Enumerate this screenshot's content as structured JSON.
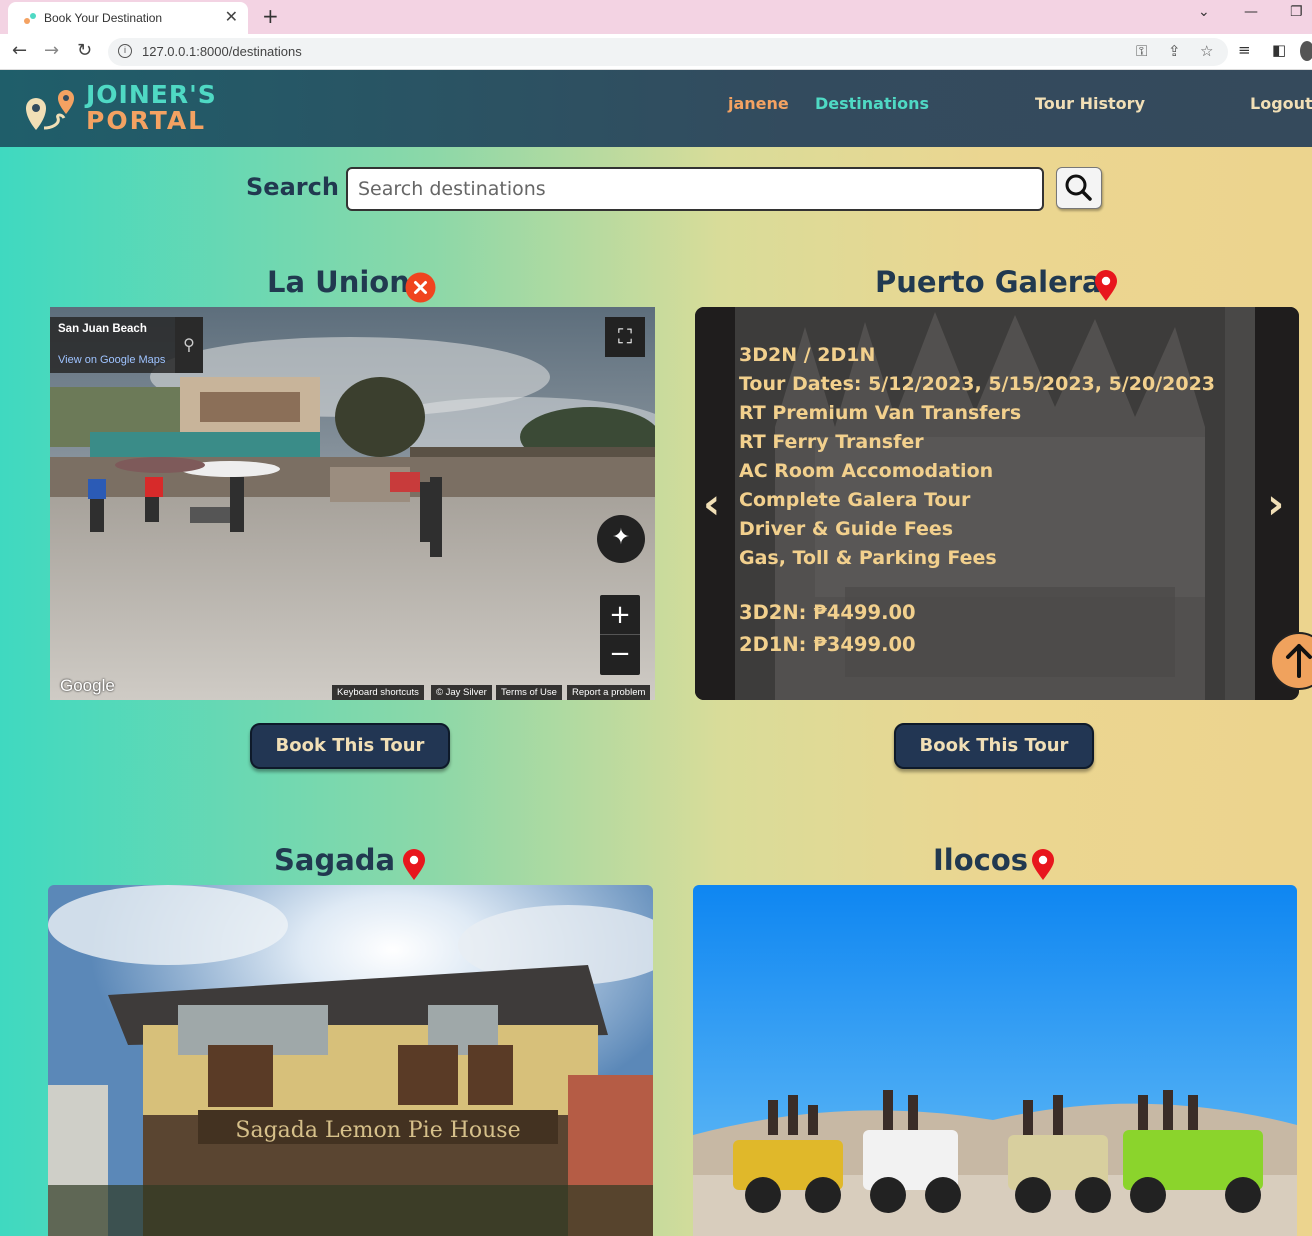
{
  "browser": {
    "tab_title": "Book Your Destination",
    "url": "127.0.0.1:8000/destinations"
  },
  "header": {
    "logo_line1": "JOINER'S",
    "logo_line2": "PORTAL",
    "user": "janene",
    "nav": [
      "Destinations",
      "Tour History",
      "Logout"
    ]
  },
  "search": {
    "label": "Search",
    "placeholder": "Search destinations"
  },
  "destinations": [
    {
      "name": "La Union",
      "streetview": {
        "place": "San Juan Beach",
        "link": "View on Google Maps",
        "footer": [
          "Keyboard shortcuts",
          "© Jay Silver",
          "Terms of Use",
          "Report a problem"
        ],
        "brand": "Google"
      },
      "button": "Book This Tour"
    },
    {
      "name": "Puerto Galera",
      "details": [
        "3D2N / 2D1N",
        "Tour Dates: 5/12/2023, 5/15/2023, 5/20/2023",
        "RT Premium Van Transfers",
        "RT Ferry Transfer",
        "AC Room Accomodation",
        "Complete Galera Tour",
        "Driver & Guide Fees",
        "Gas, Toll & Parking Fees"
      ],
      "prices": [
        "3D2N: ₱4499.00",
        "2D1N: ₱3499.00"
      ],
      "button": "Book This Tour"
    },
    {
      "name": "Sagada",
      "sign_text": "Sagada Lemon Pie House"
    },
    {
      "name": "Ilocos"
    }
  ],
  "colors": {
    "primary": "#223653",
    "accent_orange": "#f4a262",
    "accent_teal": "#4fd9c4",
    "cream": "#f1dfb6",
    "pin_red": "#e8161d"
  }
}
